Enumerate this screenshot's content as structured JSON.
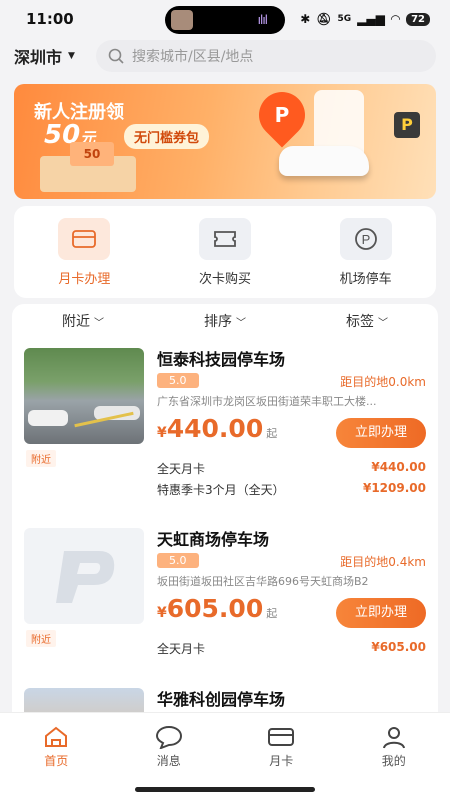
{
  "status": {
    "time": "11:00",
    "battery": "72",
    "network": "5G"
  },
  "header": {
    "city": "深圳市",
    "search_placeholder": "搜索城市/区县/地点"
  },
  "banner": {
    "line1": "新人注册领",
    "amount": "50",
    "unit": "元",
    "tag": "无门槛券包",
    "note": "50"
  },
  "quick": [
    {
      "label": "月卡办理",
      "icon": "card-icon",
      "active": true
    },
    {
      "label": "次卡购买",
      "icon": "ticket-icon",
      "active": false
    },
    {
      "label": "机场停车",
      "icon": "parking-icon",
      "active": false
    }
  ],
  "filters": [
    "附近",
    "排序",
    "标签"
  ],
  "lots": [
    {
      "name": "恒泰科技园停车场",
      "rating": "5.0",
      "distance": "距目的地0.0km",
      "address": "广东省深圳市龙岗区坂田街道荣丰职工大楼...",
      "currency": "¥",
      "price": "440.00",
      "price_suffix": "起",
      "button": "立即办理",
      "near_tag": "附近",
      "plans": [
        {
          "name": "全天月卡",
          "price": "¥440.00"
        },
        {
          "name": "特惠季卡3个月（全天）",
          "price": "¥1209.00"
        }
      ]
    },
    {
      "name": "天虹商场停车场",
      "rating": "5.0",
      "distance": "距目的地0.4km",
      "address": "坂田街道坂田社区吉华路696号天虹商场B2",
      "currency": "¥",
      "price": "605.00",
      "price_suffix": "起",
      "button": "立即办理",
      "near_tag": "附近",
      "plans": [
        {
          "name": "全天月卡",
          "price": "¥605.00"
        }
      ]
    },
    {
      "name": "华雅科创园停车场"
    }
  ],
  "tabs": [
    {
      "label": "首页",
      "icon": "home-icon",
      "active": true
    },
    {
      "label": "消息",
      "icon": "message-icon",
      "active": false
    },
    {
      "label": "月卡",
      "icon": "card-icon",
      "active": false
    },
    {
      "label": "我的",
      "icon": "user-icon",
      "active": false
    }
  ],
  "colors": {
    "accent": "#e86a2a",
    "background": "#f3f3f5"
  }
}
